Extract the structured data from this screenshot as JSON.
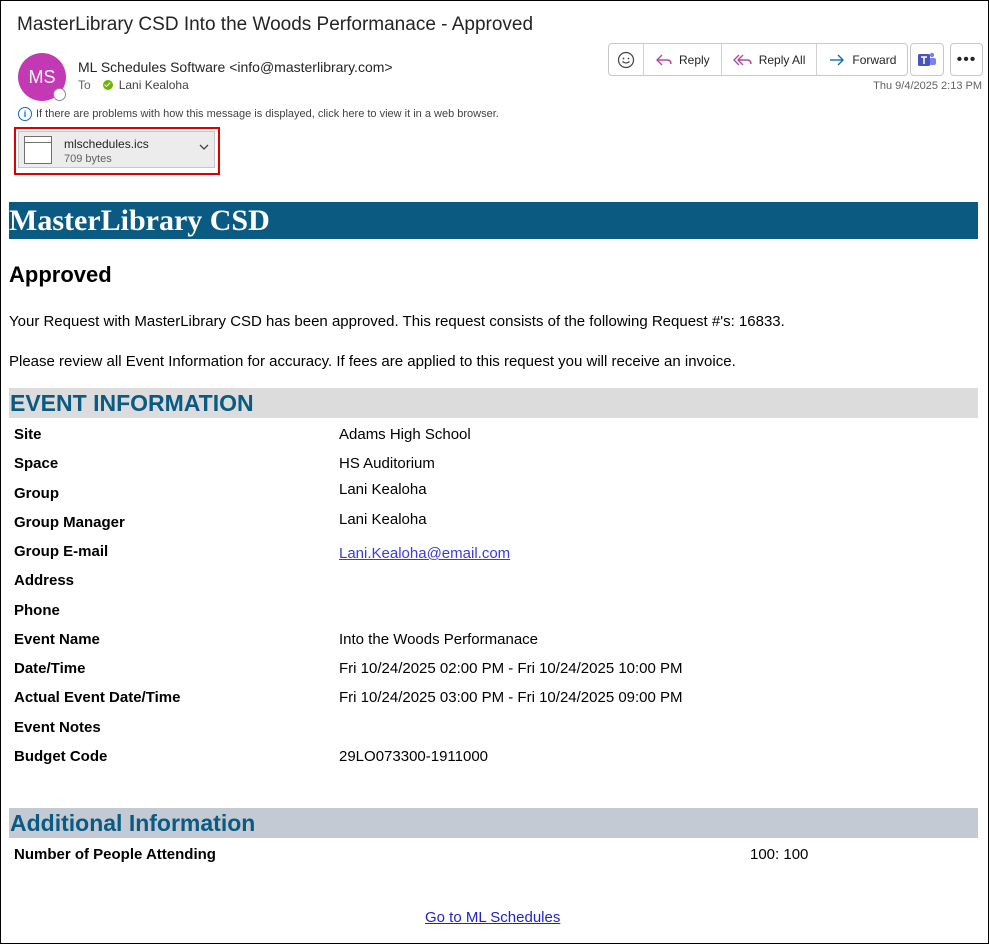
{
  "email": {
    "subject": "MasterLibrary CSD Into the Woods Performanace - Approved",
    "avatar_initials": "MS",
    "sender": "ML Schedules Software <info@masterlibrary.com>",
    "to_label": "To",
    "recipient": "Lani Kealoha",
    "timestamp": "Thu 9/4/2025 2:13 PM",
    "info_text": "If there are problems with how this message is displayed, click here to view it in a web browser."
  },
  "toolbar": {
    "reply": "Reply",
    "reply_all": "Reply All",
    "forward": "Forward"
  },
  "attachment": {
    "name": "mlschedules.ics",
    "size": "709 bytes"
  },
  "body": {
    "banner": "MasterLibrary CSD",
    "heading": "Approved",
    "para1": "Your Request with MasterLibrary CSD has been approved. This request consists of the following Request #'s: 16833.",
    "para2": "Please review all Event Information for accuracy. If fees are applied to this request you will receive an invoice.",
    "event_section_title": "EVENT INFORMATION",
    "event_rows": [
      {
        "label": "Site",
        "value": "Adams High School"
      },
      {
        "label": "Space",
        "value": "HS Auditorium"
      },
      {
        "label": "Group",
        "value": "Lani Kealoha"
      },
      {
        "label": "Group Manager",
        "value": "Lani Kealoha"
      },
      {
        "label": "Group E-mail",
        "value": "Lani.Kealoha@email.com"
      },
      {
        "label": "Address",
        "value": ""
      },
      {
        "label": "Phone",
        "value": ""
      },
      {
        "label": "Event Name",
        "value": "Into the Woods Performanace"
      },
      {
        "label": "Date/Time",
        "value": "Fri 10/24/2025 02:00 PM - Fri 10/24/2025 10:00 PM"
      },
      {
        "label": "Actual Event Date/Time",
        "value": "Fri 10/24/2025 03:00 PM - Fri 10/24/2025 09:00 PM"
      },
      {
        "label": "Event Notes",
        "value": ""
      },
      {
        "label": "Budget Code",
        "value": "29LO073300-1911000"
      }
    ],
    "additional_section_title": "Additional Information",
    "attending_label": "Number of People Attending",
    "attending_value": "100: 100",
    "footer_link": "Go to ML Schedules"
  },
  "colors": {
    "banner": "#0a5a82",
    "avatar": "#c239b3",
    "section1_bg": "#dcdcdc",
    "section2_bg": "#c4cad4"
  }
}
